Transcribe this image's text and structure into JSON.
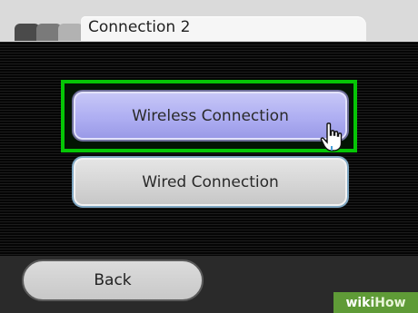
{
  "header": {
    "title": "Connection 2"
  },
  "menu": {
    "wireless_label": "Wireless Connection",
    "wired_label": "Wired Connection",
    "selected": "Wireless Connection"
  },
  "footer": {
    "back_label": "Back"
  },
  "watermark": {
    "prefix": "wiki",
    "suffix": "How"
  },
  "colors": {
    "highlight": "#06c606",
    "selected_button": "#aeaef2",
    "unselected_button": "#d5d5d5"
  },
  "icons": [
    "hand-pointer-icon"
  ]
}
